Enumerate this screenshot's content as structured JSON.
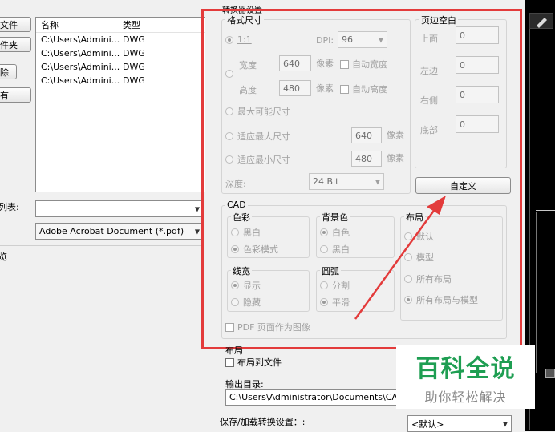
{
  "left_panel": {
    "buttons": [
      "文件",
      "件夹",
      "除",
      "有"
    ],
    "list": {
      "headers": {
        "name": "名称",
        "type": "类型"
      },
      "rows": [
        {
          "name": "C:\\Users\\Admini...",
          "type": "DWG"
        },
        {
          "name": "C:\\Users\\Admini...",
          "type": "DWG"
        },
        {
          "name": "C:\\Users\\Admini...",
          "type": "DWG"
        },
        {
          "name": "C:\\Users\\Admini...",
          "type": "DWG"
        }
      ]
    },
    "list_label": "列表:",
    "list_combo_value": "",
    "format_combo_value": "Adobe Acrobat Document (*.pdf)",
    "bottom_label": "览"
  },
  "converter": {
    "title": "转换器设置",
    "format": {
      "group_label": "格式尺寸",
      "ratio_label": "1:1",
      "dpi_label": "DPI:",
      "dpi_value": "96",
      "width_label": "宽度",
      "width_value": "640",
      "height_label": "高度",
      "height_value": "480",
      "unit": "像素",
      "auto_width": "自动宽度",
      "auto_height": "自动高度",
      "max_size": "最大可能尺寸",
      "fit_max": "适应最大尺寸",
      "fit_max_value": "640",
      "fit_min": "适应最小尺寸",
      "fit_min_value": "480",
      "depth_label": "深度:",
      "depth_value": "24 Bit"
    },
    "margins": {
      "group_label": "页边空白",
      "top_label": "上面",
      "top_value": "0",
      "left_label": "左边",
      "left_value": "0",
      "right_label": "右侧",
      "right_value": "0",
      "bottom_label": "底部",
      "bottom_value": "0"
    },
    "custom_button": "自定义",
    "cad": {
      "label": "CAD",
      "color": {
        "label": "色彩",
        "opt1": "黑白",
        "opt2": "色彩模式"
      },
      "background": {
        "label": "背景色",
        "opt1": "白色",
        "opt2": "黑白"
      },
      "layout": {
        "label": "布局",
        "opt1": "默认",
        "opt2": "模型",
        "opt3": "所有布局",
        "opt4": "所有布局与模型"
      },
      "lineweight": {
        "label": "线宽",
        "opt1": "显示",
        "opt2": "隐藏"
      },
      "arc": {
        "label": "圆弧",
        "opt1": "分割",
        "opt2": "平滑"
      },
      "pdf_as_image": "PDF 页面作为图像"
    },
    "layout_section": {
      "label": "布局",
      "layout_to_file": "布局到文件"
    },
    "output_label": "输出目录:",
    "output_value": "C:\\Users\\Administrator\\Documents\\CADEdit",
    "save_label": "保存/加载转换设置：:",
    "save_value": "<默认>"
  },
  "watermark": {
    "title": "百科全说",
    "subtitle": "助你轻松解决"
  },
  "colors": {
    "annotation": "#e33b3b",
    "watermark_green": "#1e9e52"
  }
}
